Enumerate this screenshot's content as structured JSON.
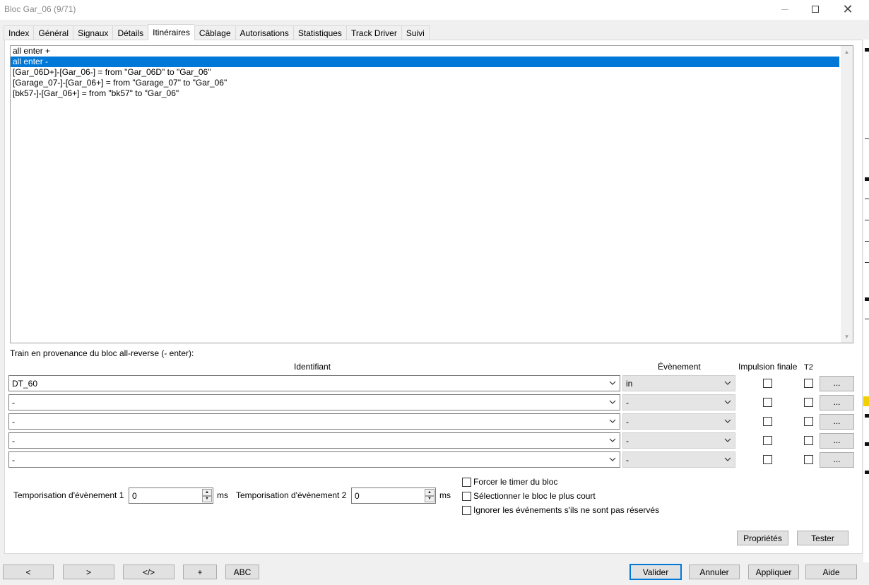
{
  "window": {
    "title": "Bloc Gar_06 (9/71)"
  },
  "tabs": [
    {
      "label": "Index",
      "active": false
    },
    {
      "label": "Général",
      "active": false
    },
    {
      "label": "Signaux",
      "active": false
    },
    {
      "label": "Détails",
      "active": false
    },
    {
      "label": "Itinéraires",
      "active": true
    },
    {
      "label": "Câblage",
      "active": false
    },
    {
      "label": "Autorisations",
      "active": false
    },
    {
      "label": "Statistiques",
      "active": false
    },
    {
      "label": "Track Driver",
      "active": false
    },
    {
      "label": "Suivi",
      "active": false
    }
  ],
  "routes": {
    "items": [
      {
        "label": "all enter +",
        "selected": false
      },
      {
        "label": "all enter -",
        "selected": true
      },
      {
        "label": "[Gar_06D+]-[Gar_06-] = from \"Gar_06D\" to \"Gar_06\"",
        "selected": false
      },
      {
        "label": "[Garage_07-]-[Gar_06+] = from \"Garage_07\" to \"Gar_06\"",
        "selected": false
      },
      {
        "label": "[bk57-]-[Gar_06+] = from \"bk57\" to \"Gar_06\"",
        "selected": false
      }
    ]
  },
  "events": {
    "caption": "Train en provenance du bloc all-reverse (- enter):",
    "headers": {
      "identifier": "Identifiant",
      "event": "Évènement",
      "pulse": "Impulsion finale",
      "t2": "T2"
    },
    "rows": [
      {
        "identifier": "DT_60",
        "event": "in",
        "pulse": false,
        "t2": false,
        "more": "..."
      },
      {
        "identifier": "-",
        "event": "-",
        "pulse": false,
        "t2": false,
        "more": "..."
      },
      {
        "identifier": "-",
        "event": "-",
        "pulse": false,
        "t2": false,
        "more": "..."
      },
      {
        "identifier": "-",
        "event": "-",
        "pulse": false,
        "t2": false,
        "more": "..."
      },
      {
        "identifier": "-",
        "event": "-",
        "pulse": false,
        "t2": false,
        "more": "..."
      }
    ]
  },
  "timers": {
    "timer1_label": "Temporisation d'évènement 1",
    "timer1_value": "0",
    "timer2_label": "Temporisation d'évènement 2",
    "timer2_value": "0",
    "unit": "ms"
  },
  "options": {
    "force_timer": "Forcer le timer du bloc",
    "shortest": "Sélectionner le bloc le plus court",
    "ignore_unreserved": "Ignorer les événements s'ils ne sont pas réservés"
  },
  "panel_buttons": {
    "properties": "Propriétés",
    "test": "Tester"
  },
  "footer": {
    "prev": "<",
    "next": ">",
    "code": "</>",
    "add": "+",
    "abc": "ABC",
    "ok": "Valider",
    "cancel": "Annuler",
    "apply": "Appliquer",
    "help": "Aide"
  }
}
